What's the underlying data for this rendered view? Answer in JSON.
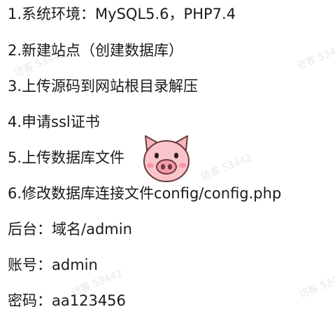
{
  "lines": [
    "1.系统环境：MySQL5.6，PHP7.4",
    "2.新建站点（创建数据库）",
    "3.上传源码到网站根目录解压",
    "4.申请ssl证书",
    "5.上传数据库文件",
    "6.修改数据库连接文件config/config.php",
    "后台：域名/admin",
    "账号：admin",
    "密码：aa123456"
  ],
  "watermark": {
    "text": "访客 53442"
  },
  "colors": {
    "text": "#1a1a1a",
    "pig_face": "#f7b7c0",
    "pig_snout": "#f59aa8",
    "watermark": "#e8e8e8"
  },
  "icons": {
    "pig": "pig-face-icon"
  }
}
